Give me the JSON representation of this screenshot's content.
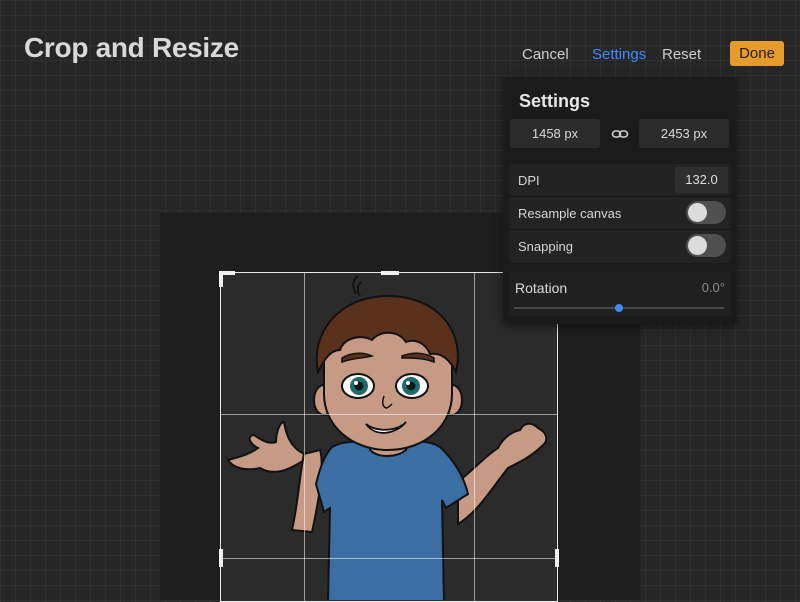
{
  "header": {
    "title": "Crop and Resize",
    "cancel_label": "Cancel",
    "settings_label": "Settings",
    "reset_label": "Reset",
    "done_label": "Done"
  },
  "settings_panel": {
    "title": "Settings",
    "width_value": "1458 px",
    "height_value": "2453 px",
    "dpi_label": "DPI",
    "dpi_value": "132.0",
    "resample_label": "Resample canvas",
    "resample_on": false,
    "snapping_label": "Snapping",
    "snapping_on": false,
    "rotation_label": "Rotation",
    "rotation_value": "0.0°",
    "rotation_slider_fraction": 0.5
  },
  "colors": {
    "accent": "#3d8bff",
    "done_button": "#e59c2c",
    "shirt": "#3b6fa4",
    "hair": "#5a321c",
    "skin": "#c69a84"
  },
  "icons": {
    "link": "link-icon"
  }
}
